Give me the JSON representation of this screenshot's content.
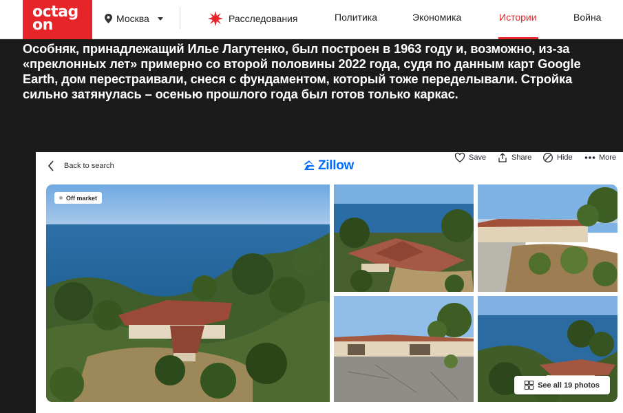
{
  "header": {
    "logo_line1": "octag",
    "logo_line2": "on",
    "city": "Москва",
    "nav": {
      "investigations": "Расследования",
      "politics": "Политика",
      "economy": "Экономика",
      "stories": "Истории",
      "war": "Война"
    },
    "accent_color": "#e5252a"
  },
  "article": {
    "caption": "Особняк, принадлежащий Илье Лагутенко, был построен в 1963 году и, возможно, из-за «преклонных лет» примерно со второй половины 2022 года, судя по данным карт Google Earth, дом перестраивали, снеся с фундаментом, который тоже переделывали. Стройка сильно затянулась – осенью прошлого года был готов только каркас."
  },
  "zillow": {
    "back_label": "Back to search",
    "brand": "Zillow",
    "brand_color": "#006aff",
    "actions": {
      "save": "Save",
      "share": "Share",
      "hide": "Hide",
      "more": "More"
    },
    "status_badge": "Off market",
    "see_all_label": "See all 19 photos",
    "icons": [
      "chevron-left-icon",
      "zillow-logo-icon",
      "heart-icon",
      "share-icon",
      "hide-icon",
      "more-dots-icon",
      "grid-icon"
    ]
  }
}
